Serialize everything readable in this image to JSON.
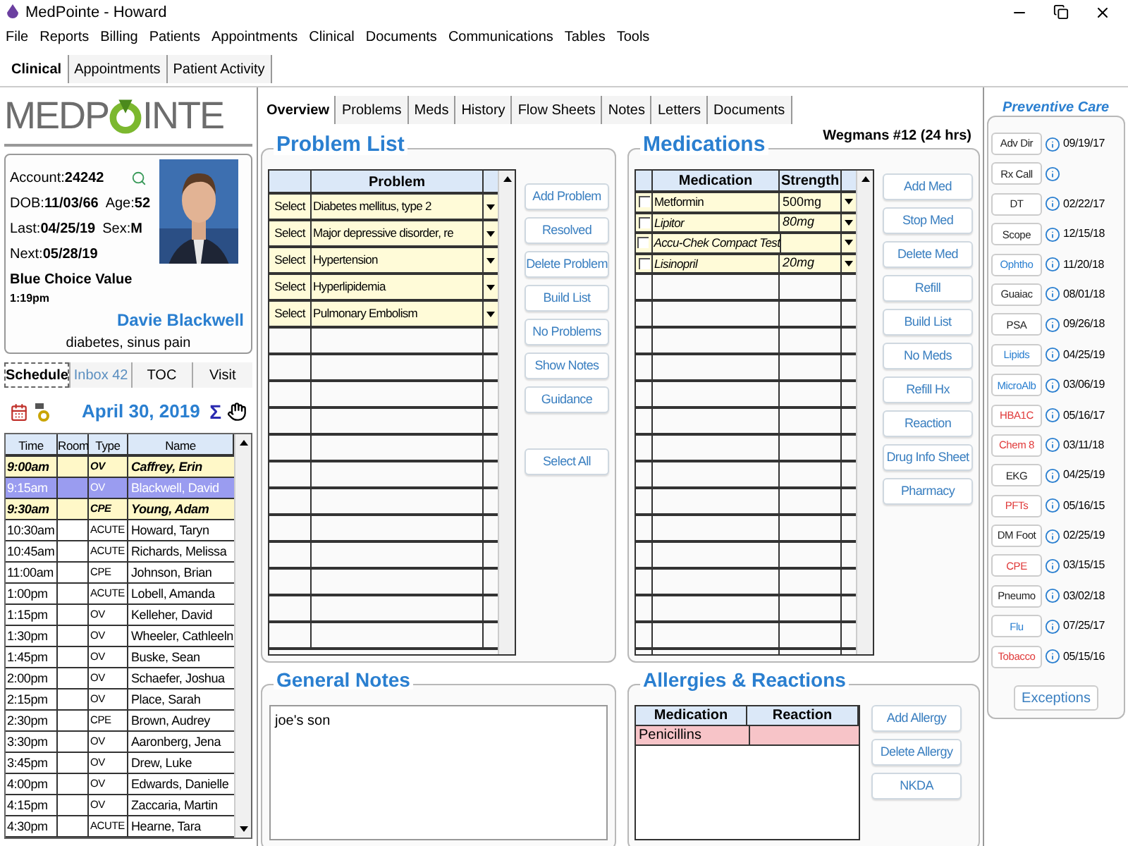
{
  "window": {
    "title": "MedPointe - Howard"
  },
  "menu": [
    "File",
    "Reports",
    "Billing",
    "Patients",
    "Appointments",
    "Clinical",
    "Documents",
    "Communications",
    "Tables",
    "Tools"
  ],
  "main_tabs": [
    {
      "label": "Clinical",
      "selected": true
    },
    {
      "label": "Appointments",
      "selected": false
    },
    {
      "label": "Patient Activity",
      "selected": false
    }
  ],
  "logo": {
    "left": "MEDP",
    "right": "INTE"
  },
  "patient": {
    "rows": [
      [
        {
          "label": "Account:",
          "value": "24242"
        }
      ],
      [
        {
          "label": "DOB:",
          "value": "11/03/66"
        },
        {
          "label": "Age:",
          "value": "52"
        }
      ],
      [
        {
          "label": "Last:",
          "value": "04/25/19"
        },
        {
          "label": "Sex:",
          "value": "M"
        }
      ],
      [
        {
          "label": "Next:",
          "value": "05/28/19"
        }
      ]
    ],
    "plan": "Blue Choice Value",
    "time": "1:19pm",
    "name": "Davie Blackwell",
    "complaint": "diabetes, sinus pain"
  },
  "side_tabs": [
    {
      "label": "Schedule",
      "selected": true,
      "color": "#000000"
    },
    {
      "label": "Inbox 42",
      "selected": false,
      "color": "#5b8fc0"
    },
    {
      "label": "TOC",
      "selected": false,
      "color": "#000000"
    },
    {
      "label": "Visit",
      "selected": false,
      "color": "#000000"
    }
  ],
  "schedule": {
    "date": "April 30, 2019",
    "sigma": "Σ",
    "columns": [
      "Time",
      "Room",
      "Type",
      "Name"
    ],
    "rows": [
      {
        "time": "9:00am",
        "type": "OV",
        "name": "Caffrey, Erin",
        "highlighted": true,
        "selected": false
      },
      {
        "time": "9:15am",
        "type": "OV",
        "name": "Blackwell, David",
        "highlighted": false,
        "selected": true
      },
      {
        "time": "9:30am",
        "type": "CPE",
        "name": "Young, Adam",
        "highlighted": true,
        "selected": false
      },
      {
        "time": "10:30am",
        "type": "ACUTE",
        "name": "Howard, Taryn",
        "highlighted": false,
        "selected": false
      },
      {
        "time": "10:45am",
        "type": "ACUTE",
        "name": "Richards, Melissa",
        "highlighted": false,
        "selected": false
      },
      {
        "time": "11:00am",
        "type": "CPE",
        "name": "Johnson, Brian",
        "highlighted": false,
        "selected": false
      },
      {
        "time": "1:00pm",
        "type": "ACUTE",
        "name": "Lobell, Amanda",
        "highlighted": false,
        "selected": false
      },
      {
        "time": "1:15pm",
        "type": "OV",
        "name": "Kelleher, David",
        "highlighted": false,
        "selected": false
      },
      {
        "time": "1:30pm",
        "type": "OV",
        "name": "Wheeler, Cathleeln",
        "highlighted": false,
        "selected": false
      },
      {
        "time": "1:45pm",
        "type": "OV",
        "name": "Buske, Sean",
        "highlighted": false,
        "selected": false
      },
      {
        "time": "2:00pm",
        "type": "OV",
        "name": "Schaefer, Joshua",
        "highlighted": false,
        "selected": false
      },
      {
        "time": "2:15pm",
        "type": "OV",
        "name": "Place, Sarah",
        "highlighted": false,
        "selected": false
      },
      {
        "time": "2:30pm",
        "type": "CPE",
        "name": "Brown, Audrey",
        "highlighted": false,
        "selected": false
      },
      {
        "time": "3:30pm",
        "type": "OV",
        "name": "Aaronberg, Jena",
        "highlighted": false,
        "selected": false
      },
      {
        "time": "3:45pm",
        "type": "OV",
        "name": "Drew, Luke",
        "highlighted": false,
        "selected": false
      },
      {
        "time": "4:00pm",
        "type": "OV",
        "name": "Edwards, Danielle",
        "highlighted": false,
        "selected": false
      },
      {
        "time": "4:15pm",
        "type": "OV",
        "name": "Zaccaria, Martin",
        "highlighted": false,
        "selected": false
      },
      {
        "time": "4:30pm",
        "type": "ACUTE",
        "name": "Hearne, Tara",
        "highlighted": false,
        "selected": false
      }
    ]
  },
  "overview_tabs": [
    {
      "label": "Overview",
      "selected": true
    },
    {
      "label": "Problems",
      "selected": false
    },
    {
      "label": "Meds",
      "selected": false
    },
    {
      "label": "History",
      "selected": false
    },
    {
      "label": "Flow Sheets",
      "selected": false
    },
    {
      "label": "Notes",
      "selected": false
    },
    {
      "label": "Letters",
      "selected": false
    },
    {
      "label": "Documents",
      "selected": false
    }
  ],
  "problem_list": {
    "title": "Problem List",
    "column": "Problem",
    "rows": [
      {
        "action": "Select",
        "problem": "Diabetes mellitus, type 2"
      },
      {
        "action": "Select",
        "problem": "Major depressive disorder, re"
      },
      {
        "action": "Select",
        "problem": "Hypertension"
      },
      {
        "action": "Select",
        "problem": "Hyperlipidemia"
      },
      {
        "action": "Select",
        "problem": "Pulmonary Embolism"
      }
    ],
    "buttons": [
      "Add Problem",
      "Resolved",
      "Delete Problem",
      "Build List",
      "No Problems",
      "Show Notes",
      "Guidance"
    ],
    "bottom_button": "Select All"
  },
  "pharmacy": "Wegmans #12 (24 hrs)",
  "medications": {
    "title": "Medications",
    "columns": [
      "Medication",
      "Strength"
    ],
    "rows": [
      {
        "checked": false,
        "italic": false,
        "name": "Metformin",
        "strength": "500mg"
      },
      {
        "checked": false,
        "italic": true,
        "name": "Lipitor",
        "strength": "80mg"
      },
      {
        "checked": false,
        "italic": true,
        "name": "Accu-Chek Compact Test"
      },
      {
        "checked": false,
        "italic": true,
        "name": "Lisinopril",
        "strength": "20mg"
      }
    ],
    "buttons": [
      "Add Med",
      "Stop Med",
      "Delete Med",
      "Refill",
      "Build List",
      "No Meds",
      "Refill Hx",
      "Reaction",
      "Drug Info Sheet",
      "Pharmacy"
    ]
  },
  "general_notes": {
    "title": "General Notes",
    "text": "joe's son"
  },
  "allergies": {
    "title": "Allergies & Reactions",
    "columns": [
      "Medication",
      "Reaction"
    ],
    "rows": [
      {
        "medication": "Penicillins",
        "selected": true
      }
    ],
    "buttons": [
      "Add Allergy",
      "Delete Allergy",
      "NKDA"
    ]
  },
  "preventive_care": {
    "title": "Preventive Care",
    "items": [
      {
        "label": "Adv Dir",
        "color": "#222222",
        "date": "09/19/17"
      },
      {
        "label": "Rx Call",
        "color": "#222222"
      },
      {
        "label": "DT",
        "color": "#222222",
        "date": "02/22/17"
      },
      {
        "label": "Scope",
        "color": "#222222",
        "date": "12/15/18"
      },
      {
        "label": "Ophtho",
        "color": "#2a7fd0",
        "date": "11/20/18"
      },
      {
        "label": "Guaiac",
        "color": "#222222",
        "date": "08/01/18"
      },
      {
        "label": "PSA",
        "color": "#222222",
        "date": "09/26/18"
      },
      {
        "label": "Lipids",
        "color": "#2a7fd0",
        "date": "04/25/19"
      },
      {
        "label": "MicroAlb",
        "color": "#2a7fd0",
        "date": "03/06/19"
      },
      {
        "label": "HBA1C",
        "color": "#e03a3a",
        "date": "05/16/17"
      },
      {
        "label": "Chem 8",
        "color": "#e03a3a",
        "date": "03/11/18"
      },
      {
        "label": "EKG",
        "color": "#222222",
        "date": "04/25/19"
      },
      {
        "label": "PFTs",
        "color": "#e03a3a",
        "date": "05/16/15"
      },
      {
        "label": "DM Foot",
        "color": "#222222",
        "date": "02/25/19"
      },
      {
        "label": "CPE",
        "color": "#e03a3a",
        "date": "03/15/15"
      },
      {
        "label": "Pneumo",
        "color": "#222222",
        "date": "03/02/18"
      },
      {
        "label": "Flu",
        "color": "#2a7fd0",
        "date": "07/25/17"
      },
      {
        "label": "Tobacco",
        "color": "#e03a3a",
        "date": "05/15/16"
      }
    ],
    "exceptions": "Exceptions"
  }
}
